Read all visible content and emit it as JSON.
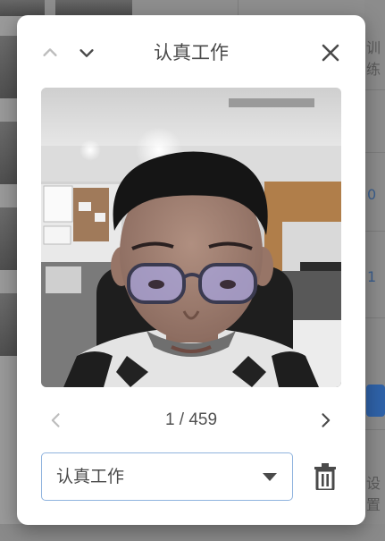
{
  "dialog": {
    "title": "认真工作",
    "pager": {
      "current": 1,
      "total": 459,
      "text": "1 / 459"
    },
    "category_select": {
      "value": "认真工作"
    },
    "icons": {
      "prev": "chevron-up-icon",
      "next": "chevron-down-icon",
      "close": "close-icon",
      "page_prev": "chevron-left-icon",
      "page_next": "chevron-right-icon",
      "dropdown": "caret-down-icon",
      "delete": "trash-icon"
    }
  },
  "background": {
    "text_right_top": "训练",
    "text_right_bottom": "设置",
    "digit_right_1": "0",
    "digit_right_2": "1"
  },
  "colors": {
    "select_border": "#8fb3de",
    "icon_dark": "#4a4a4a",
    "icon_disabled": "#bdbdbd",
    "bg_accent_blue": "#2f62a8"
  }
}
